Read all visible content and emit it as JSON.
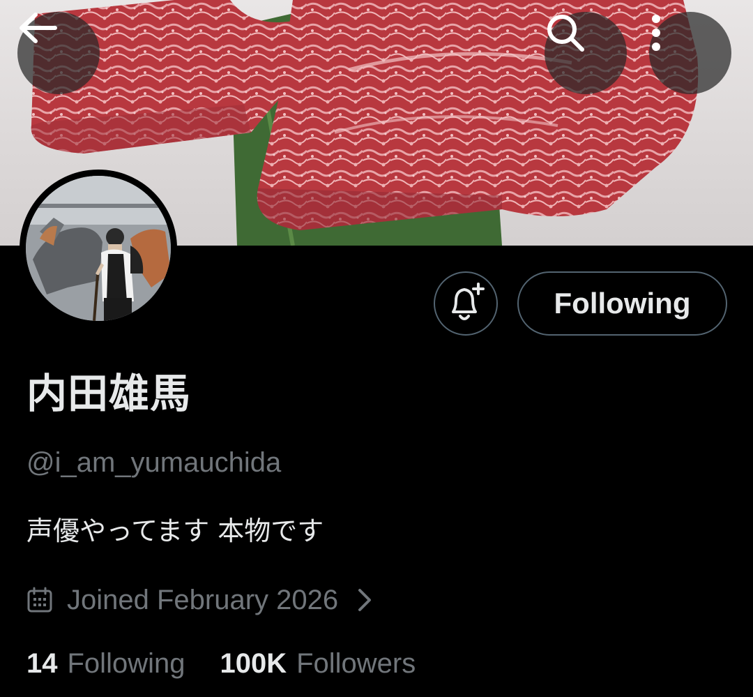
{
  "header": {
    "back_icon": "arrow-left-icon",
    "search_icon": "search-icon",
    "more_icon": "more-vertical-icon"
  },
  "banner": {
    "description_icon": "banner-image"
  },
  "profile": {
    "display_name": "内田雄馬",
    "handle": "@i_am_yumauchida",
    "bio": "声優やってます 本物です",
    "joined": "Joined February 2026",
    "following_count": "14",
    "following_label": "Following",
    "followers_count": "100K",
    "followers_label": "Followers"
  },
  "actions": {
    "notify_icon": "bell-plus-icon",
    "following_button": "Following"
  },
  "colors": {
    "background": "#000000",
    "primary_text": "#e7e9ea",
    "secondary_text": "#71767b",
    "border": "#536471"
  }
}
